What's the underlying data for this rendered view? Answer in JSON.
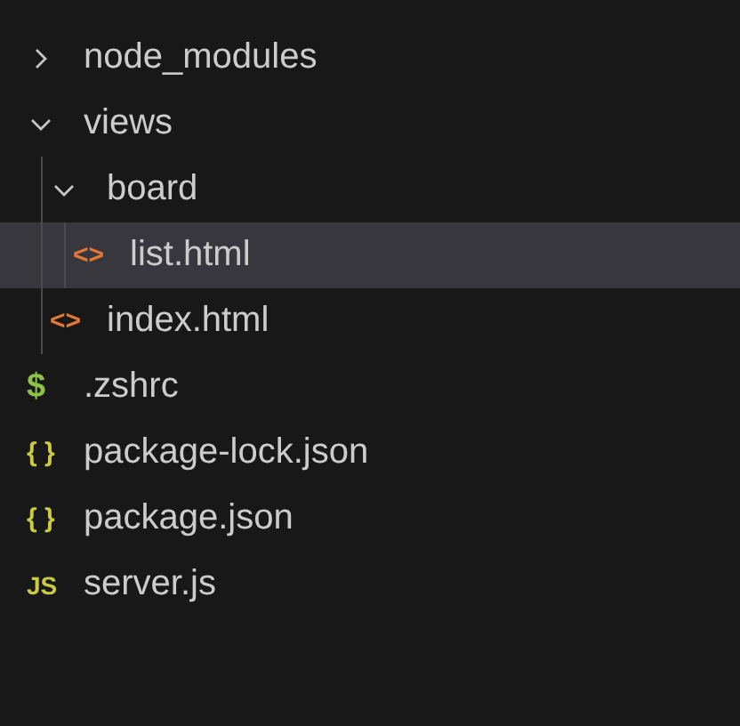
{
  "tree": [
    {
      "kind": "folder",
      "label": "node_modules",
      "expanded": false,
      "selected": false
    },
    {
      "kind": "folder",
      "label": "views",
      "expanded": true,
      "selected": false,
      "children": [
        {
          "kind": "folder",
          "label": "board",
          "expanded": true,
          "selected": false,
          "children": [
            {
              "kind": "html",
              "icon": "<>",
              "label": "list.html",
              "selected": true
            }
          ]
        },
        {
          "kind": "html",
          "icon": "<>",
          "label": "index.html",
          "selected": false
        }
      ]
    },
    {
      "kind": "shell",
      "icon": "$",
      "label": ".zshrc",
      "selected": false
    },
    {
      "kind": "json",
      "icon": "{ }",
      "label": "package-lock.json",
      "selected": false
    },
    {
      "kind": "json",
      "icon": "{ }",
      "label": "package.json",
      "selected": false
    },
    {
      "kind": "js",
      "icon": "JS",
      "label": "server.js",
      "selected": false
    }
  ]
}
